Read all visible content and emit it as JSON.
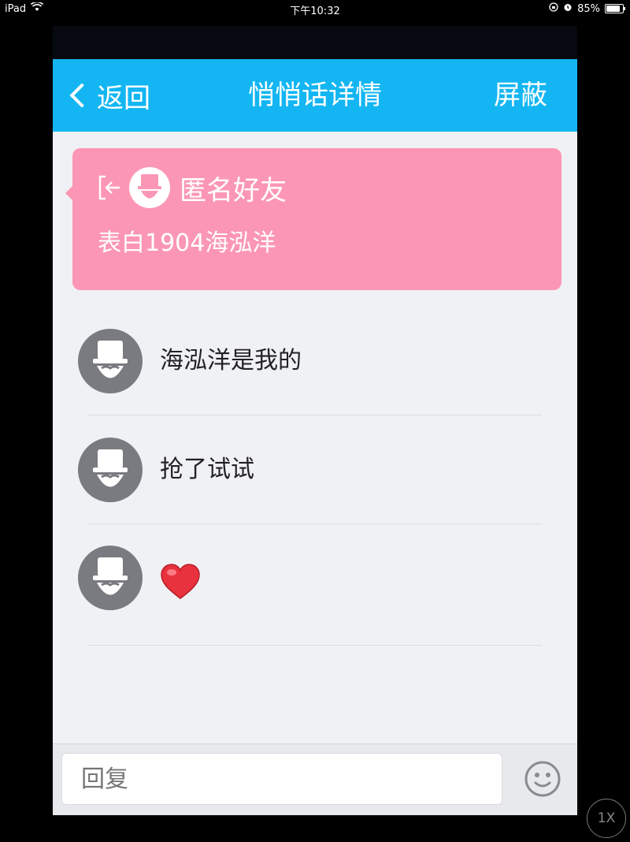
{
  "device_status": {
    "device": "iPad",
    "time": "下午10:32",
    "battery": "85%",
    "battery_fraction": 0.85
  },
  "navbar": {
    "back_label": "返回",
    "title": "悄悄话详情",
    "right_action": "屏蔽"
  },
  "post": {
    "author": "匿名好友",
    "message": "表白1904海泓洋"
  },
  "replies": [
    {
      "text": "海泓洋是我的"
    },
    {
      "text": "抢了试试"
    },
    {
      "emoji": "heart"
    }
  ],
  "reply_bar": {
    "placeholder": "回复"
  },
  "zoom_badge": "1X",
  "colors": {
    "nav_bg": "#13b6f2",
    "card_bg": "#fb97b4",
    "avatar_bg": "#7a7b80",
    "page_bg": "#f0f1f5"
  }
}
